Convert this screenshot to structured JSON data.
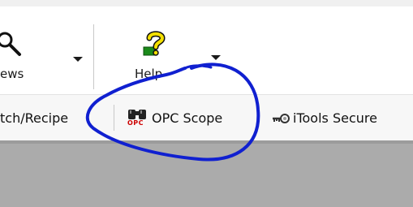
{
  "toolbar": {
    "views": {
      "label": "ews",
      "icon": "magnifier-icon"
    },
    "help": {
      "label": "Help",
      "icon": "help-question-icon"
    }
  },
  "links": [
    {
      "label": "tch/Recipe",
      "icon": ""
    },
    {
      "label": "OPC Scope",
      "icon": "binoculars-opc-icon",
      "icon_text": "OPC"
    },
    {
      "label": "iTools Secure",
      "icon": "key-icon"
    }
  ],
  "colors": {
    "annotation": "#1020d0",
    "content_background": "#ababab",
    "icon_red": "#cc0000",
    "help_yellow": "#f4e000",
    "help_green": "#1a8a1a"
  }
}
